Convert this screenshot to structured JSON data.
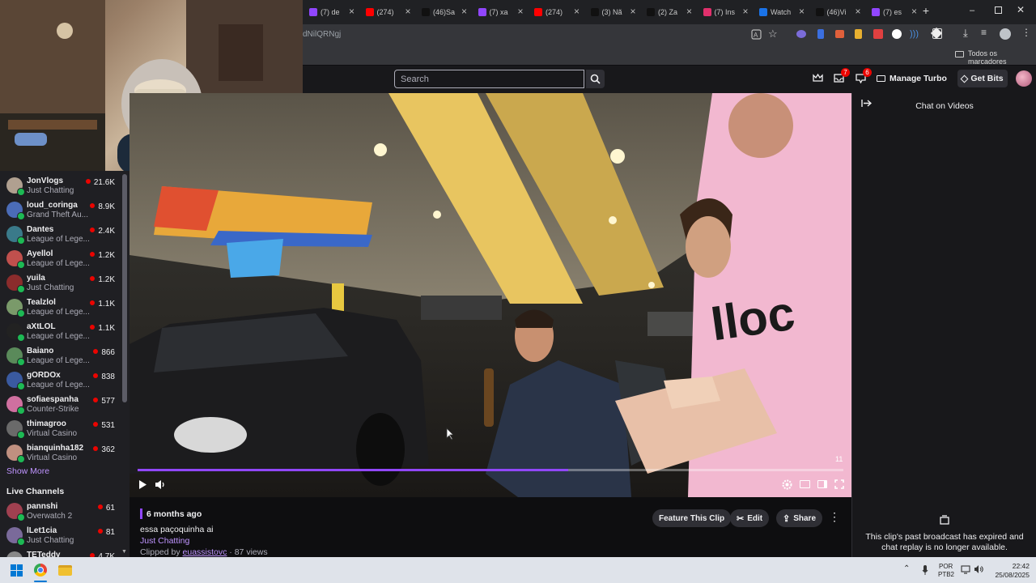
{
  "browser": {
    "tabs": [
      {
        "title": "(7) de",
        "color": "#9146ff"
      },
      {
        "title": "(274)",
        "color": "#ff0000"
      },
      {
        "title": "(46)Sa",
        "color": "#111111"
      },
      {
        "title": "(7) xa",
        "color": "#9146ff"
      },
      {
        "title": "(274)",
        "color": "#ff0000"
      },
      {
        "title": "(3) Nã",
        "color": "#111111"
      },
      {
        "title": "(2) Za",
        "color": "#111111"
      },
      {
        "title": "(7) Ins",
        "color": "#e1306c"
      },
      {
        "title": "Watch",
        "color": "#1a73e8"
      },
      {
        "title": "(46)Vi",
        "color": "#111111"
      },
      {
        "title": "(7) es",
        "color": "#9146ff"
      }
    ],
    "new_tab_symbol": "+",
    "url_fragment": "dNilQRNgj",
    "bookmarks_label": "Todos os marcadores"
  },
  "topnav": {
    "search_placeholder": "Search",
    "inbox_count": "7",
    "notif_count": "6",
    "manage_turbo": "Manage Turbo",
    "get_bits": "Get Bits"
  },
  "sidebar": {
    "channels": [
      {
        "name": "JonVlogs",
        "game": "Just Chatting",
        "viewers": "21.6K",
        "color": "#b0a090"
      },
      {
        "name": "loud_coringa",
        "game": "Grand Theft Au...",
        "viewers": "8.9K",
        "color": "#4b6cb7"
      },
      {
        "name": "Dantes",
        "game": "League of Lege...",
        "viewers": "2.4K",
        "color": "#3a7a8a"
      },
      {
        "name": "Ayellol",
        "game": "League of Lege...",
        "viewers": "1.2K",
        "color": "#c0504d"
      },
      {
        "name": "yuila",
        "game": "Just Chatting",
        "viewers": "1.2K",
        "color": "#8b2c2c"
      },
      {
        "name": "Tealzlol",
        "game": "League of Lege...",
        "viewers": "1.1K",
        "color": "#7a9a6a"
      },
      {
        "name": "aXtLOL",
        "game": "League of Lege...",
        "viewers": "1.1K",
        "color": "#222222"
      },
      {
        "name": "Baiano",
        "game": "League of Lege...",
        "viewers": "866",
        "color": "#5a8a5a"
      },
      {
        "name": "gORDOx",
        "game": "League of Lege...",
        "viewers": "838",
        "color": "#3a5aa0"
      },
      {
        "name": "sofiaespanha",
        "game": "Counter-Strike",
        "viewers": "577",
        "color": "#d070a0"
      },
      {
        "name": "thimagroo",
        "game": "Virtual Casino",
        "viewers": "531",
        "color": "#6a6a6a"
      },
      {
        "name": "bianquinha182",
        "game": "Virtual Casino",
        "viewers": "362",
        "color": "#c09080"
      }
    ],
    "show_more": "Show More",
    "live_channels_heading": "Live Channels",
    "live_channels": [
      {
        "name": "pannshi",
        "game": "Overwatch 2",
        "viewers": "61",
        "color": "#a04050"
      },
      {
        "name": "lLet1cia",
        "game": "Just Chatting",
        "viewers": "81",
        "color": "#7a6a9a"
      },
      {
        "name": "TETeddy",
        "game": "",
        "viewers": "4.7K",
        "color": "#888888"
      }
    ]
  },
  "video": {
    "timestamp_badge": "11",
    "progress_fraction": 0.61
  },
  "clip": {
    "age": "6 months ago",
    "title": "essa paçoquinha ai",
    "category": "Just Chatting",
    "clipped_by_prefix": "Clipped by ",
    "clipper": "euassistovc",
    "views": " · 87 views",
    "feature_label": "Feature This Clip",
    "edit_label": "Edit",
    "share_label": "Share"
  },
  "chat": {
    "header": "Chat on Videos",
    "expired_message": "This clip's past broadcast has expired and chat replay is no longer available."
  },
  "taskbar": {
    "lang_line1": "POR",
    "lang_line2": "PTB2",
    "time": "22:42",
    "date": "25/08/2025"
  },
  "colors": {
    "twitch_purple": "#9147ff",
    "live_red": "#eb0400",
    "notif_red": "#eb0400"
  }
}
